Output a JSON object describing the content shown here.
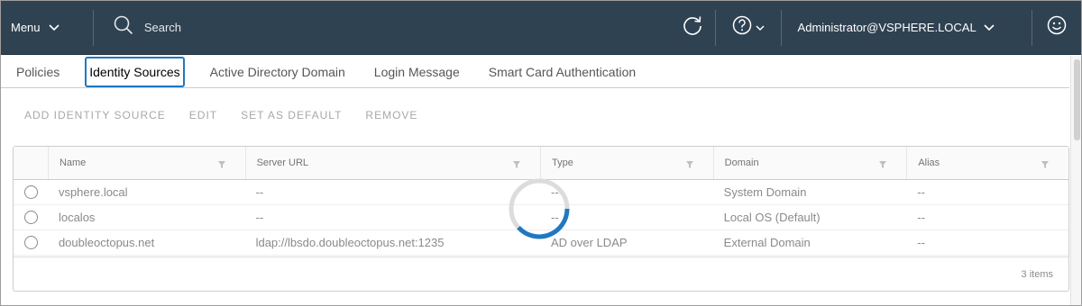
{
  "header": {
    "menu_label": "Menu",
    "search_placeholder": "Search",
    "user_label": "Administrator@VSPHERE.LOCAL",
    "icons": [
      "chevron-down-icon",
      "search-icon",
      "refresh-icon",
      "help-icon",
      "smiley-icon"
    ]
  },
  "tabs": [
    {
      "label": "Policies",
      "active": false
    },
    {
      "label": "Identity Sources",
      "active": true
    },
    {
      "label": "Active Directory Domain",
      "active": false
    },
    {
      "label": "Login Message",
      "active": false
    },
    {
      "label": "Smart Card Authentication",
      "active": false
    }
  ],
  "actions": [
    "ADD IDENTITY SOURCE",
    "EDIT",
    "SET AS DEFAULT",
    "REMOVE"
  ],
  "grid": {
    "columns": [
      "Name",
      "Server URL",
      "Type",
      "Domain",
      "Alias"
    ],
    "rows": [
      {
        "name": "vsphere.local",
        "url": "--",
        "type": "--",
        "domain": "System Domain",
        "alias": "--"
      },
      {
        "name": "localos",
        "url": "--",
        "type": "--",
        "domain": "Local OS (Default)",
        "alias": "--"
      },
      {
        "name": "doubleoctopus.net",
        "url": "ldap://lbsdo.doubleoctopus.net:1235",
        "type": "AD over LDAP",
        "domain": "External Domain",
        "alias": "--"
      }
    ],
    "footer": "3 items"
  },
  "colors": {
    "header_bg": "#2f4252",
    "active_tab_border": "#1f78c1",
    "spinner": "#1f78c1"
  }
}
